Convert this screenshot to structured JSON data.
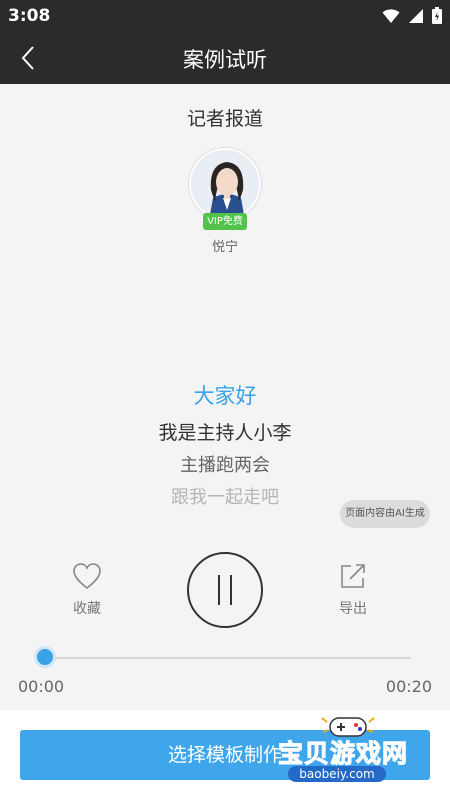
{
  "status_bar": {
    "time": "3:08"
  },
  "header": {
    "title": "案例试听"
  },
  "category": "记者报道",
  "anchor": {
    "vip_label": "VIP免费",
    "name": "悦宁"
  },
  "lyrics": [
    "大家好",
    "我是主持人小李",
    "主播跑两会",
    "跟我一起走吧"
  ],
  "ai_notice": "页面内容由AI生成",
  "controls": {
    "favorite": "收藏",
    "export": "导出"
  },
  "progress": {
    "current": "00:00",
    "total": "00:20",
    "fraction": 0.0
  },
  "bottom": {
    "select_template": "选择模板制作"
  },
  "watermark": {
    "name": "宝贝游戏网",
    "domain": "baobeiy.com"
  },
  "colors": {
    "accent": "#3aa3e8",
    "button": "#3fa6ec",
    "header": "#2b2b2b",
    "vip": "#53c24b"
  }
}
